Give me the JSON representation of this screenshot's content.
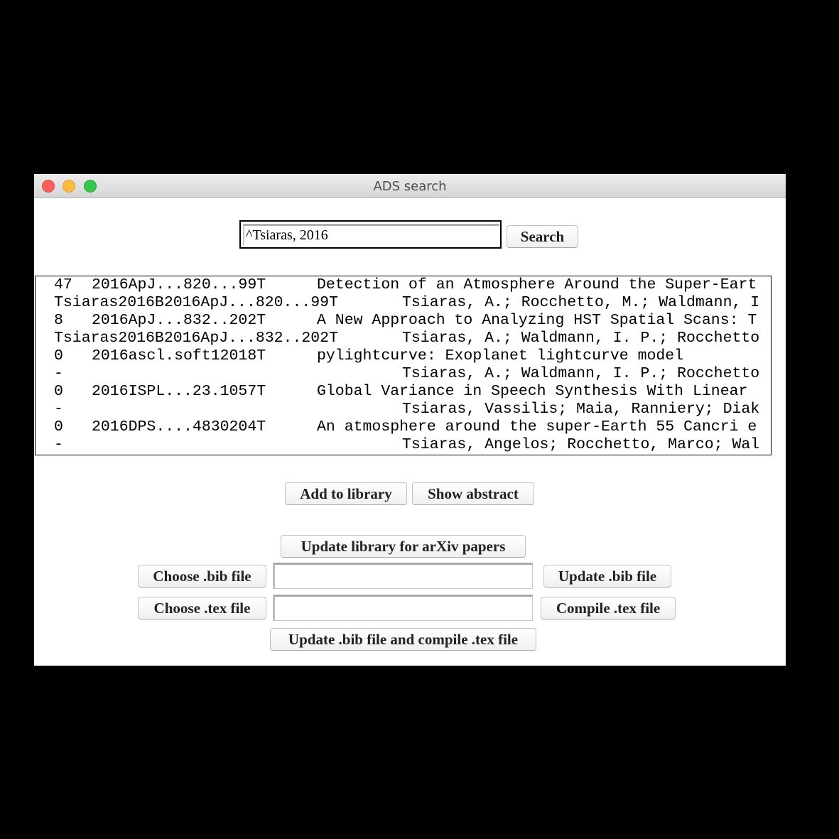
{
  "window": {
    "title": "ADS search"
  },
  "search": {
    "value": "^Tsiaras, 2016",
    "button_label": "Search"
  },
  "results": {
    "rows": [
      {
        "col1": "47",
        "col2": "2016ApJ...820...99T",
        "col3": "Detection of an Atmosphere Around the Super-Eart"
      },
      {
        "col1": "Tsiaras2016B2016ApJ...820...99T",
        "col2": "",
        "col3": "Tsiaras, A.; Rocchetto, M.; Waldmann, I"
      },
      {
        "col1": "8",
        "col2": "2016ApJ...832..202T",
        "col3": "A New Approach to Analyzing HST Spatial Scans: T"
      },
      {
        "col1": "Tsiaras2016B2016ApJ...832..202T",
        "col2": "",
        "col3": "Tsiaras, A.; Waldmann, I. P.; Rocchetto"
      },
      {
        "col1": "0",
        "col2": "2016ascl.soft12018T",
        "col3": "pylightcurve: Exoplanet lightcurve model"
      },
      {
        "col1": "-",
        "col2": "",
        "col3": "Tsiaras, A.; Waldmann, I. P.; Rocchetto"
      },
      {
        "col1": "0",
        "col2": "2016ISPL...23.1057T",
        "col3": "Global Variance in Speech Synthesis With Linear "
      },
      {
        "col1": "-",
        "col2": "",
        "col3": "Tsiaras, Vassilis; Maia, Ranniery; Diak"
      },
      {
        "col1": "0",
        "col2": "2016DPS....4830204T",
        "col3": "An atmosphere around the super-Earth 55 Cancri e"
      },
      {
        "col1": "-",
        "col2": "",
        "col3": "Tsiaras, Angelos; Rocchetto, Marco; Wal"
      }
    ]
  },
  "actions": {
    "add_to_library": "Add to library",
    "show_abstract": "Show abstract",
    "update_arxiv": "Update library for arXiv papers",
    "choose_bib": "Choose .bib file",
    "bib_path": "",
    "update_bib": "Update .bib file",
    "choose_tex": "Choose .tex file",
    "tex_path": "",
    "compile_tex": "Compile .tex file",
    "update_and_compile": "Update .bib file and compile .tex file"
  }
}
